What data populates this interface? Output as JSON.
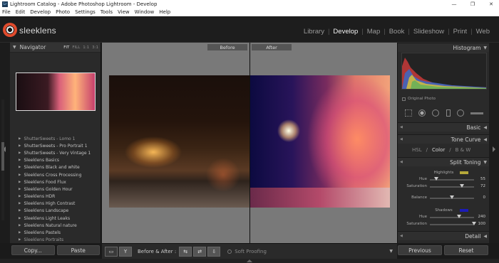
{
  "window": {
    "title": "Lightroom Catalog - Adobe Photoshop Lightroom - Develop",
    "app_icon": "Lr",
    "controls": [
      "—",
      "❐",
      "✕"
    ]
  },
  "menubar": [
    "File",
    "Edit",
    "Develop",
    "Photo",
    "Settings",
    "Tools",
    "View",
    "Window",
    "Help"
  ],
  "brand": "sleeklens",
  "modules": [
    {
      "label": "Library",
      "active": false
    },
    {
      "label": "Develop",
      "active": true
    },
    {
      "label": "Map",
      "active": false
    },
    {
      "label": "Book",
      "active": false
    },
    {
      "label": "Slideshow",
      "active": false
    },
    {
      "label": "Print",
      "active": false
    },
    {
      "label": "Web",
      "active": false
    }
  ],
  "navigator": {
    "title": "Navigator",
    "zoom": [
      "FIT",
      "FILL",
      "1:1",
      "3:1"
    ]
  },
  "presets": [
    "ShutterSweets - Lomo 1",
    "ShutterSweets - Pro Portrait 1",
    "ShutterSweets - Very Vintage 1",
    "Sleeklens Basics",
    "Sleeklens Black and white",
    "Sleeklens Cross Processing",
    "Sleeklens Food Flux",
    "Sleeklens Golden Hour",
    "Sleeklens HDR",
    "Sleeklens High Contrast",
    "Sleeklens Landscape",
    "Sleeklens Light Leaks",
    "Sleeklens Natural nature",
    "Sleeklens Pastels",
    "Sleeklens Portraits"
  ],
  "left_buttons": {
    "copy": "Copy...",
    "paste": "Paste"
  },
  "view": {
    "before": "Before",
    "after": "After"
  },
  "toolbar": {
    "before_after": "Before & After :",
    "soft_proofing": "Soft Proofing",
    "icon_single": "▭",
    "icon_split": "Y",
    "icon_swap1": "⇆",
    "icon_swap2": "⇄",
    "icon_copy": "⇩"
  },
  "right_panel": {
    "histogram": "Histogram",
    "original_photo": "Original Photo",
    "basic": "Basic",
    "tone_curve": "Tone Curve",
    "hsl": "HSL",
    "color": "Color",
    "bw": "B & W",
    "split_toning": "Split Toning",
    "highlights": "Highlights",
    "shadows": "Shadows",
    "balance": "Balance",
    "detail": "Detail",
    "highlights_hue_label": "Hue",
    "highlights_hue": 55,
    "highlights_saturation_label": "Saturation",
    "highlights_saturation": 72,
    "balance_value": 0,
    "shadows_hue_label": "Hue",
    "shadows_hue": 240,
    "shadows_saturation_label": "Saturation",
    "shadows_saturation": 100,
    "highlight_swatch": "#b5a83a",
    "shadow_swatch": "#1c1cb8"
  },
  "right_buttons": {
    "previous": "Previous",
    "reset": "Reset"
  }
}
